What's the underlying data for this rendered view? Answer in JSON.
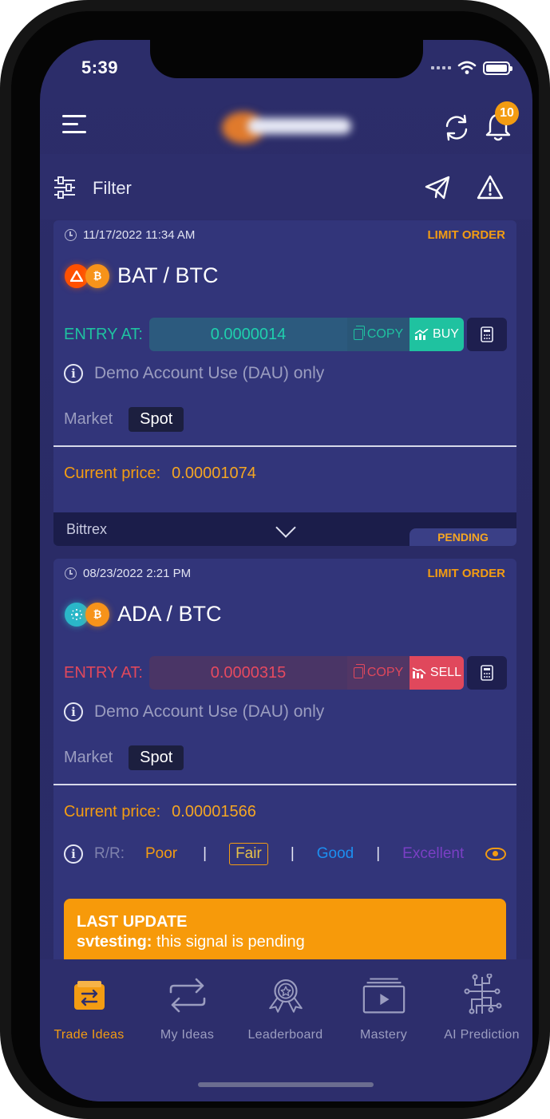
{
  "status_bar": {
    "time": "5:39"
  },
  "header": {
    "notification_count": "10"
  },
  "filter": {
    "label": "Filter"
  },
  "cards": [
    {
      "timestamp": "11/17/2022 11:34 AM",
      "order_type": "LIMIT ORDER",
      "pair": "BAT / BTC",
      "entry_label": "ENTRY AT:",
      "entry_value": "0.0000014",
      "copy_label": "COPY",
      "action_label": "BUY",
      "demo_note": "Demo Account Use (DAU) only",
      "market_label": "Market",
      "market_value": "Spot",
      "current_price_label": "Current price:",
      "current_price_value": "0.00001074",
      "exchange": "Bittrex",
      "status": "PENDING"
    },
    {
      "timestamp": "08/23/2022 2:21 PM",
      "order_type": "LIMIT ORDER",
      "pair": "ADA / BTC",
      "entry_label": "ENTRY AT:",
      "entry_value": "0.0000315",
      "copy_label": "COPY",
      "action_label": "SELL",
      "demo_note": "Demo Account Use (DAU) only",
      "market_label": "Market",
      "market_value": "Spot",
      "current_price_label": "Current price:",
      "current_price_value": "0.00001566",
      "rr": {
        "label": "R/R:",
        "poor": "Poor",
        "fair": "Fair",
        "good": "Good",
        "excellent": "Excellent",
        "selected": "Fair"
      },
      "last_update": {
        "title": "LAST UPDATE",
        "user": "svtesting:",
        "message": " this signal is pending"
      }
    }
  ],
  "tabs": [
    {
      "label": "Trade Ideas",
      "icon": "trade-ideas-icon",
      "active": true
    },
    {
      "label": "My Ideas",
      "icon": "swap-arrows-icon",
      "active": false
    },
    {
      "label": "Leaderboard",
      "icon": "award-badge-icon",
      "active": false
    },
    {
      "label": "Mastery",
      "icon": "video-play-icon",
      "active": false
    },
    {
      "label": "AI Prediction",
      "icon": "circuit-icon",
      "active": false
    }
  ],
  "colors": {
    "background": "#2b2c69",
    "card": "#32357a",
    "accent_orange": "#f39c12",
    "buy_green": "#1fc2a0",
    "sell_red": "#e0485c"
  }
}
